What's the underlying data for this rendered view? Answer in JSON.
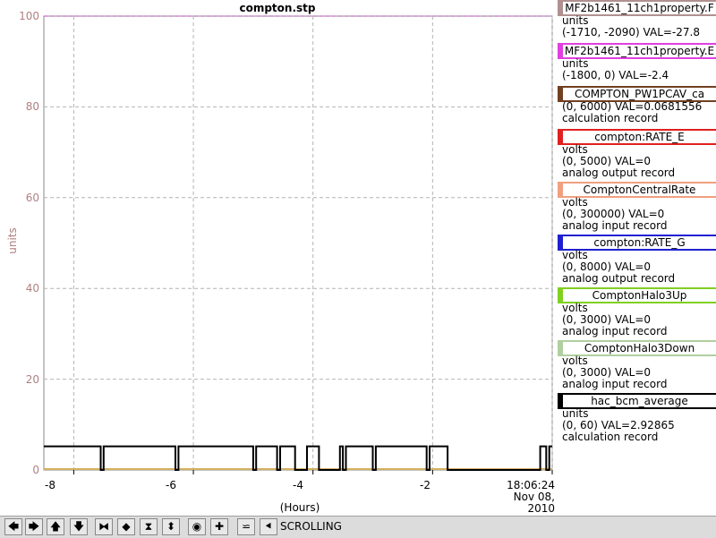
{
  "window": {
    "title": "compton.stp"
  },
  "plot": {
    "ylabel": "units",
    "yticks": [
      "0",
      "20",
      "40",
      "60",
      "80",
      "100"
    ],
    "xticks": [
      "-8",
      "-6",
      "-4",
      "-2"
    ],
    "xlabel": "(Hours)",
    "time_label": [
      "18:06:24",
      "Nov 08, 2010"
    ],
    "colors": {
      "grid": "#b4b4b4",
      "limit": "#c040c0",
      "axis_text": "#b08080",
      "trace": "#000000",
      "baseline": "#d4b060"
    }
  },
  "legend": [
    {
      "name": "MF2b1461_11ch1property.F",
      "color": "#b09090",
      "lines": [
        "units",
        "(-1710, -2090) VAL=-27.8"
      ]
    },
    {
      "name": "MF2b1461_11ch1property.E",
      "color": "#e040e0",
      "lines": [
        "units",
        "(-1800, 0) VAL=-2.4"
      ]
    },
    {
      "name": "COMPTON_PW1PCAV_ca",
      "color": "#704020",
      "lines": [
        "(0, 6000) VAL=0.0681556",
        "calculation record"
      ]
    },
    {
      "name": "compton:RATE_E",
      "color": "#e02020",
      "lines": [
        "volts",
        "(0, 5000) VAL=0",
        "analog output record"
      ]
    },
    {
      "name": "ComptonCentralRate",
      "color": "#f0a080",
      "lines": [
        "volts",
        "(0, 300000) VAL=0",
        "analog input record"
      ]
    },
    {
      "name": "compton:RATE_G",
      "color": "#2020d0",
      "lines": [
        "volts",
        "(0, 8000) VAL=0",
        "analog output record"
      ]
    },
    {
      "name": "ComptonHalo3Up",
      "color": "#80d020",
      "lines": [
        "volts",
        "(0, 3000) VAL=0",
        "analog input record"
      ]
    },
    {
      "name": "ComptonHalo3Down",
      "color": "#b0d0a0",
      "lines": [
        "volts",
        "(0, 3000) VAL=0",
        "analog input record"
      ]
    },
    {
      "name": "hac_bcm_average",
      "color": "#000000",
      "lines": [
        "units",
        "(0, 60) VAL=2.92865",
        "calculation record"
      ]
    }
  ],
  "toolbar": {
    "buttons": [
      {
        "name": "pan-left-button",
        "glyph": "🡄"
      },
      {
        "name": "pan-right-button",
        "glyph": "🡆"
      },
      {
        "name": "pan-up-button",
        "glyph": "🡅"
      },
      {
        "name": "pan-down-button",
        "glyph": "🡇"
      },
      {
        "name": "zoom-in-x-button",
        "glyph": "⧓"
      },
      {
        "name": "zoom-out-x-button",
        "glyph": "◆"
      },
      {
        "name": "zoom-in-y-button",
        "glyph": "⧗"
      },
      {
        "name": "zoom-out-y-button",
        "glyph": "⬍"
      },
      {
        "name": "reset-button",
        "glyph": "◉"
      },
      {
        "name": "add-button",
        "glyph": "✚"
      },
      {
        "name": "autoscale-button",
        "glyph": "⋍"
      },
      {
        "name": "back-button",
        "glyph": "⯇"
      }
    ],
    "scroll_label": "SCROLLING"
  }
}
